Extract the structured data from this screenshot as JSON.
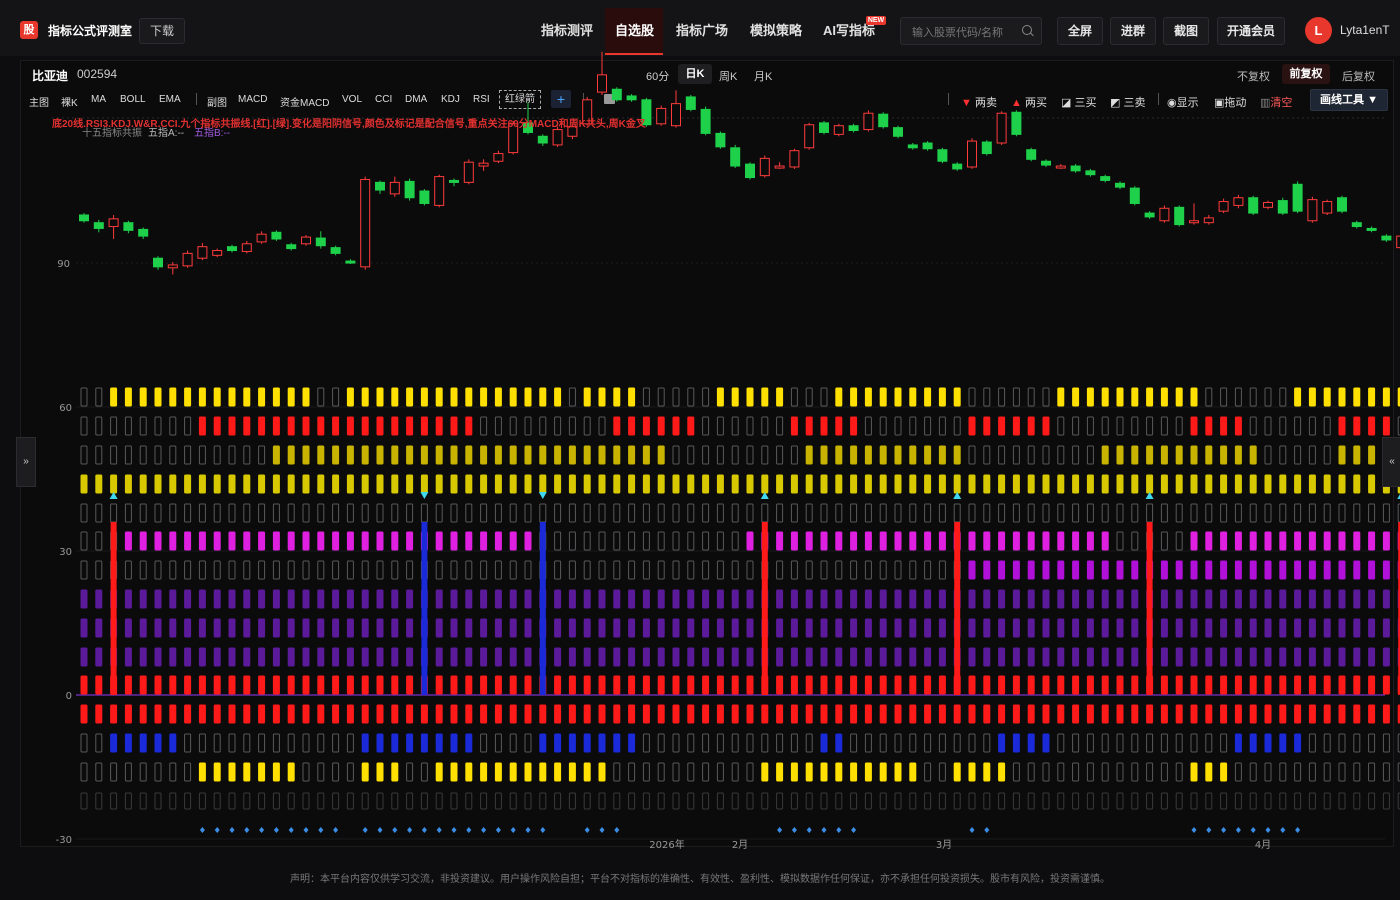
{
  "header": {
    "logo_text": "股",
    "brand": "指标公式评测室",
    "download": "下载",
    "nav": [
      "指标测评",
      "自选股",
      "指标广场",
      "模拟策略",
      "AI写指标"
    ],
    "nav_active": "自选股",
    "new_badge": "NEW",
    "search_placeholder": "输入股票代码/名称",
    "buttons": [
      "全屏",
      "进群",
      "截图",
      "开通会员"
    ],
    "avatar": "L",
    "username": "Lyta1enT"
  },
  "stock": {
    "name": "比亚迪",
    "code": "002594"
  },
  "periods": [
    "60分",
    "日K",
    "周K",
    "月K"
  ],
  "period_active": "日K",
  "adjust": [
    "不复权",
    "前复权",
    "后复权"
  ],
  "adjust_active": "前复权",
  "indicators": [
    "主图",
    "裸K",
    "MA",
    "BOLL",
    "EMA",
    "副图",
    "MACD",
    "资金MACD",
    "VOL",
    "CCI",
    "DMA",
    "KDJ",
    "RSI"
  ],
  "indicator_custom": "红绿箭",
  "tools": [
    "两卖",
    "两买",
    "三买",
    "三卖",
    "显示",
    "拖动",
    "清空"
  ],
  "draw_tool": "画线工具 ▼",
  "formula_text": "底20线.RSI3.KDJ.W&R.CCI.九个指标共振线.[红].[绿].变化是阳阴信号,颜色及标记是配合信号,重点关注60分MACD和周K共头,周K金叉",
  "legend": {
    "a": "十五指标共振",
    "b": "五指A:--",
    "c": "五指B:--"
  },
  "side_left": "»",
  "side_right": "«",
  "footer": "声明：本平台内容仅供学习交流，非投资建议。用户操作风险自担；平台不对指标的准确性、有效性、盈利性、模拟数据作任何保证，亦不承担任何投资损失。股市有风险，投资需谨慎。",
  "chart_data": {
    "type": "candlestick+indicator",
    "price_axis_ticks": [
      90
    ],
    "indicator_axis_ticks": [
      60,
      30,
      0,
      -30
    ],
    "x_labels": [
      "2026年",
      "2月",
      "3月",
      "4月"
    ],
    "candles": [
      {
        "o": 95.0,
        "c": 94.4,
        "h": 95.2,
        "l": 94.2
      },
      {
        "o": 94.2,
        "c": 93.6,
        "h": 94.5,
        "l": 93.2
      },
      {
        "o": 93.8,
        "c": 94.6,
        "h": 95.0,
        "l": 92.5
      },
      {
        "o": 94.2,
        "c": 93.4,
        "h": 94.4,
        "l": 93.1
      },
      {
        "o": 93.5,
        "c": 92.8,
        "h": 93.7,
        "l": 92.5
      },
      {
        "o": 90.5,
        "c": 89.6,
        "h": 90.7,
        "l": 89.3
      },
      {
        "o": 89.5,
        "c": 89.8,
        "h": 90.1,
        "l": 88.8
      },
      {
        "o": 89.7,
        "c": 91.0,
        "h": 91.3,
        "l": 89.5
      },
      {
        "o": 90.5,
        "c": 91.7,
        "h": 92.1,
        "l": 90.3
      },
      {
        "o": 90.8,
        "c": 91.3,
        "h": 91.5,
        "l": 90.6
      },
      {
        "o": 91.7,
        "c": 91.3,
        "h": 91.9,
        "l": 91.1
      },
      {
        "o": 91.2,
        "c": 92.0,
        "h": 92.3,
        "l": 91.0
      },
      {
        "o": 92.2,
        "c": 93.0,
        "h": 93.3,
        "l": 92.0
      },
      {
        "o": 93.2,
        "c": 92.5,
        "h": 93.4,
        "l": 92.3
      },
      {
        "o": 91.9,
        "c": 91.5,
        "h": 92.1,
        "l": 91.3
      },
      {
        "o": 92.0,
        "c": 92.7,
        "h": 92.9,
        "l": 91.8
      },
      {
        "o": 92.6,
        "c": 91.8,
        "h": 93.3,
        "l": 91.5
      },
      {
        "o": 91.6,
        "c": 91.0,
        "h": 91.8,
        "l": 90.8
      },
      {
        "o": 90.2,
        "c": 90.0,
        "h": 90.4,
        "l": 89.9
      },
      {
        "o": 89.6,
        "c": 98.7,
        "h": 99.0,
        "l": 89.3
      },
      {
        "o": 98.4,
        "c": 97.6,
        "h": 98.6,
        "l": 97.2
      },
      {
        "o": 97.2,
        "c": 98.4,
        "h": 99.0,
        "l": 96.9
      },
      {
        "o": 98.5,
        "c": 96.8,
        "h": 98.8,
        "l": 96.5
      },
      {
        "o": 97.5,
        "c": 96.2,
        "h": 97.7,
        "l": 96.0
      },
      {
        "o": 96.0,
        "c": 99.0,
        "h": 99.2,
        "l": 95.8
      },
      {
        "o": 98.6,
        "c": 98.4,
        "h": 98.8,
        "l": 98.0
      },
      {
        "o": 98.4,
        "c": 100.5,
        "h": 100.8,
        "l": 98.2
      },
      {
        "o": 100.1,
        "c": 100.4,
        "h": 100.8,
        "l": 99.6
      },
      {
        "o": 100.6,
        "c": 101.4,
        "h": 101.7,
        "l": 100.4
      },
      {
        "o": 101.5,
        "c": 104.5,
        "h": 104.8,
        "l": 101.3
      },
      {
        "o": 104.6,
        "c": 103.6,
        "h": 106.7,
        "l": 103.4
      },
      {
        "o": 103.2,
        "c": 102.5,
        "h": 103.4,
        "l": 102.2
      },
      {
        "o": 102.3,
        "c": 103.9,
        "h": 104.2,
        "l": 102.1
      },
      {
        "o": 103.2,
        "c": 104.2,
        "h": 104.4,
        "l": 102.9
      },
      {
        "o": 104.5,
        "c": 107.0,
        "h": 107.3,
        "l": 104.3
      },
      {
        "o": 107.8,
        "c": 109.6,
        "h": 112.0,
        "l": 107.5
      },
      {
        "o": 108.1,
        "c": 107.0,
        "h": 108.3,
        "l": 106.8
      },
      {
        "o": 107.4,
        "c": 107.0,
        "h": 107.6,
        "l": 106.8
      },
      {
        "o": 107.0,
        "c": 104.4,
        "h": 107.2,
        "l": 104.2
      },
      {
        "o": 104.5,
        "c": 106.1,
        "h": 106.4,
        "l": 104.3
      },
      {
        "o": 104.3,
        "c": 106.6,
        "h": 108.0,
        "l": 104.1
      },
      {
        "o": 107.3,
        "c": 106.0,
        "h": 107.5,
        "l": 105.8
      },
      {
        "o": 106.0,
        "c": 103.5,
        "h": 106.3,
        "l": 103.3
      },
      {
        "o": 103.5,
        "c": 102.1,
        "h": 103.7,
        "l": 101.9
      },
      {
        "o": 102.0,
        "c": 100.1,
        "h": 102.3,
        "l": 99.9
      },
      {
        "o": 100.3,
        "c": 98.9,
        "h": 100.5,
        "l": 98.7
      },
      {
        "o": 99.1,
        "c": 100.9,
        "h": 101.2,
        "l": 98.9
      },
      {
        "o": 100.0,
        "c": 100.1,
        "h": 100.5,
        "l": 99.8
      },
      {
        "o": 100.0,
        "c": 101.7,
        "h": 101.9,
        "l": 99.8
      },
      {
        "o": 102.0,
        "c": 104.4,
        "h": 104.6,
        "l": 101.8
      },
      {
        "o": 104.6,
        "c": 103.6,
        "h": 104.8,
        "l": 103.4
      },
      {
        "o": 103.4,
        "c": 104.3,
        "h": 104.5,
        "l": 103.2
      },
      {
        "o": 104.3,
        "c": 103.8,
        "h": 104.5,
        "l": 103.6
      },
      {
        "o": 103.9,
        "c": 105.6,
        "h": 105.9,
        "l": 103.7
      },
      {
        "o": 105.5,
        "c": 104.2,
        "h": 105.7,
        "l": 104.0
      },
      {
        "o": 104.1,
        "c": 103.2,
        "h": 104.3,
        "l": 103.0
      },
      {
        "o": 102.3,
        "c": 102.0,
        "h": 102.5,
        "l": 101.8
      },
      {
        "o": 102.5,
        "c": 101.9,
        "h": 102.7,
        "l": 101.7
      },
      {
        "o": 101.8,
        "c": 100.6,
        "h": 102.0,
        "l": 100.4
      },
      {
        "o": 100.3,
        "c": 99.8,
        "h": 100.5,
        "l": 99.6
      },
      {
        "o": 100.0,
        "c": 102.7,
        "h": 103.0,
        "l": 99.8
      },
      {
        "o": 102.6,
        "c": 101.4,
        "h": 102.8,
        "l": 101.2
      },
      {
        "o": 102.5,
        "c": 105.6,
        "h": 105.8,
        "l": 102.3
      },
      {
        "o": 105.7,
        "c": 103.4,
        "h": 105.9,
        "l": 103.2
      },
      {
        "o": 101.8,
        "c": 100.8,
        "h": 102.0,
        "l": 100.6
      },
      {
        "o": 100.6,
        "c": 100.2,
        "h": 100.8,
        "l": 100.0
      },
      {
        "o": 100.0,
        "c": 100.1,
        "h": 100.3,
        "l": 99.8
      },
      {
        "o": 100.1,
        "c": 99.6,
        "h": 100.3,
        "l": 99.4
      },
      {
        "o": 99.6,
        "c": 99.2,
        "h": 99.8,
        "l": 99.0
      },
      {
        "o": 99.0,
        "c": 98.6,
        "h": 99.2,
        "l": 98.4
      },
      {
        "o": 98.3,
        "c": 97.9,
        "h": 98.5,
        "l": 97.7
      },
      {
        "o": 97.8,
        "c": 96.2,
        "h": 98.0,
        "l": 96.0
      },
      {
        "o": 95.2,
        "c": 94.8,
        "h": 95.4,
        "l": 94.6
      },
      {
        "o": 94.4,
        "c": 95.7,
        "h": 96.0,
        "l": 94.2
      },
      {
        "o": 95.8,
        "c": 94.0,
        "h": 96.0,
        "l": 93.8
      },
      {
        "o": 94.2,
        "c": 94.4,
        "h": 96.2,
        "l": 94.0
      },
      {
        "o": 94.2,
        "c": 94.7,
        "h": 95.0,
        "l": 94.0
      },
      {
        "o": 95.4,
        "c": 96.4,
        "h": 96.7,
        "l": 95.2
      },
      {
        "o": 96.0,
        "c": 96.8,
        "h": 97.1,
        "l": 95.7
      },
      {
        "o": 96.8,
        "c": 95.2,
        "h": 97.0,
        "l": 95.0
      },
      {
        "o": 95.8,
        "c": 96.3,
        "h": 96.5,
        "l": 95.6
      },
      {
        "o": 96.5,
        "c": 95.2,
        "h": 96.8,
        "l": 95.0
      },
      {
        "o": 98.2,
        "c": 95.4,
        "h": 98.5,
        "l": 95.2
      },
      {
        "o": 94.4,
        "c": 96.6,
        "h": 96.9,
        "l": 94.2
      },
      {
        "o": 95.2,
        "c": 96.4,
        "h": 96.6,
        "l": 95.0
      },
      {
        "o": 96.8,
        "c": 95.4,
        "h": 97.0,
        "l": 95.2
      },
      {
        "o": 94.2,
        "c": 93.8,
        "h": 94.4,
        "l": 93.6
      },
      {
        "o": 93.6,
        "c": 93.4,
        "h": 93.8,
        "l": 93.2
      },
      {
        "o": 92.8,
        "c": 92.4,
        "h": 93.0,
        "l": 92.2
      },
      {
        "o": 91.6,
        "c": 92.8,
        "h": 93.0,
        "l": 91.4
      },
      {
        "o": 91.8,
        "c": 92.4,
        "h": 92.6,
        "l": 91.6
      },
      {
        "o": 91.6,
        "c": 91.2,
        "h": 91.8,
        "l": 91.0
      },
      {
        "o": 90.8,
        "c": 90.2,
        "h": 91.0,
        "l": 89.8
      },
      {
        "o": 90.2,
        "c": 91.4,
        "h": 91.7,
        "l": 90.0
      }
    ],
    "signal_rows": [
      {
        "value": 60,
        "color": "#ffe000",
        "on": "0011111111111111111111111111111111111111111111111111111111111111111111111111111111111111111111111111"
      },
      {
        "value": 55,
        "color": "#ff1a1a",
        "on": "0000000000000000000000000000000000000000000000000000000000000000000000000000000000000000000000000000"
      },
      {
        "value": 50,
        "color": "#d6c200",
        "on": "0000000000000000000000000000000000000000000000000000000000000000000000000000000000000000000000000000"
      },
      {
        "value": 45,
        "color": "#e0d000",
        "on": "0000000000000000000000000000000000000000000000000000000000000000000000000000000000000000000000000000"
      },
      {
        "value": 30,
        "color": "#e020e0",
        "on": "0000000000000000000000000000000000000000000000000000000000000000000000000000000000000000000000000000"
      },
      {
        "value": 25,
        "color": "#b010d8",
        "on": "0000000000000000000000000000000000000000000000000000000000000000000000000000000000000000000000000000"
      }
    ]
  }
}
